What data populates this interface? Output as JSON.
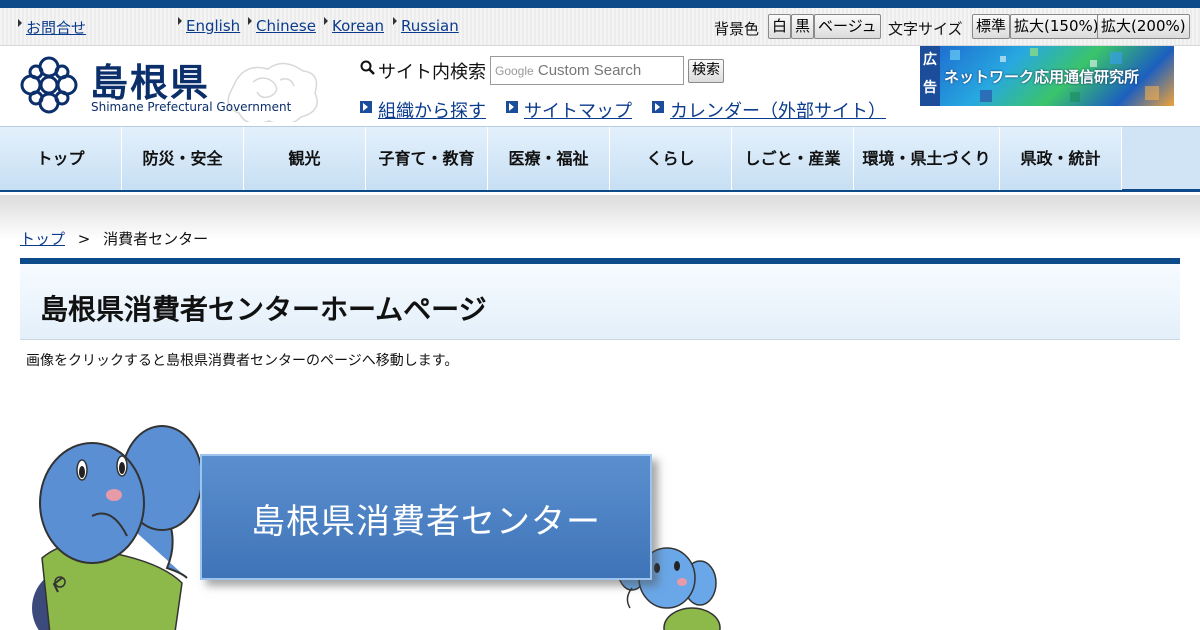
{
  "utility": {
    "contact": "お問合せ",
    "languages": [
      "English",
      "Chinese",
      "Korean",
      "Russian"
    ],
    "bg_label": "背景色",
    "bg_options": [
      "白",
      "黒",
      "ベージュ"
    ],
    "font_label": "文字サイズ",
    "font_options": [
      "標準",
      "拡大(150%)",
      "拡大(200%)"
    ]
  },
  "header": {
    "logo_title": "島根県",
    "logo_subtitle": "Shimane Prefectural Government",
    "search_label": "サイト内検索",
    "search_placeholder": "Custom Search",
    "search_brand": "Google",
    "search_button": "検索",
    "links": [
      "組織から探す",
      "サイトマップ",
      "カレンダー（外部サイト）"
    ],
    "ad_tag": "広告",
    "ad_text": "ネットワーク応用通信研究所"
  },
  "nav": {
    "items": [
      "トップ",
      "防災・安全",
      "観光",
      "子育て・教育",
      "医療・福祉",
      "くらし",
      "しごと・産業",
      "環境・県土づくり",
      "県政・統計"
    ]
  },
  "breadcrumb": {
    "home": "トップ",
    "separator": ">",
    "current": "消費者センター"
  },
  "main": {
    "title": "島根県消費者センターホームページ",
    "description": "画像をクリックすると島根県消費者センターのページへ移動します。",
    "banner_text": "島根県消費者センター"
  },
  "colors": {
    "brand": "#0d4a8a",
    "link": "#0b3b8c",
    "nav_bg": "#d0e4f6",
    "banner_blue": "#4a80c4"
  }
}
